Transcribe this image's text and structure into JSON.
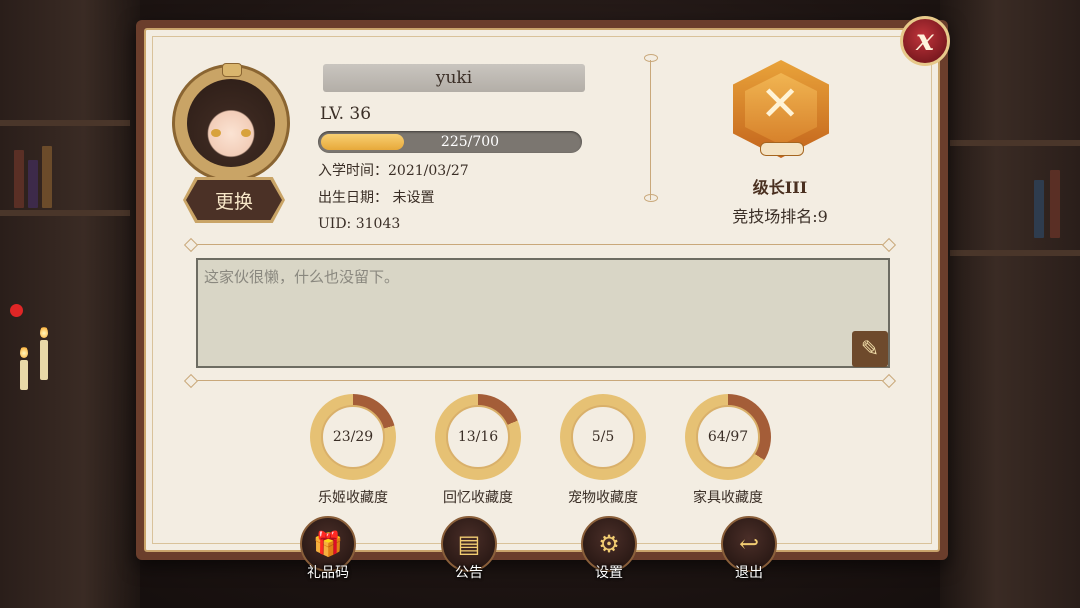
{
  "profile": {
    "name": "yuki",
    "level": "LV. 36",
    "exp_text": "225/700",
    "exp_fraction": 0.321,
    "enroll": "入学时间：2021/03/27",
    "birthday": "出生日期： 未设置",
    "uid": "UID:   31043",
    "change_label": "更换"
  },
  "rank": {
    "title": "级长III",
    "arena": "竞技场排名:9"
  },
  "signature": {
    "text": "这家伙很懒，什么也没留下。",
    "edit_icon": "quill-icon"
  },
  "collections": [
    {
      "value": "23/29",
      "label": "乐姬收藏度",
      "fraction": 0.793
    },
    {
      "value": "13/16",
      "label": "回忆收藏度",
      "fraction": 0.8125
    },
    {
      "value": "5/5",
      "label": "宠物收藏度",
      "fraction": 1.0
    },
    {
      "value": "64/97",
      "label": "家具收藏度",
      "fraction": 0.66
    }
  ],
  "bottom_buttons": [
    {
      "label": "礼品码",
      "icon": "gift-icon"
    },
    {
      "label": "公告",
      "icon": "folder-icon"
    },
    {
      "label": "设置",
      "icon": "gear-icon"
    },
    {
      "label": "退出",
      "icon": "return-icon"
    }
  ],
  "colors": {
    "panel_bg": "#f3ede2",
    "ring_gold": "#e6c174",
    "ring_progress": "#a45d38",
    "close_red": "#c0343b"
  }
}
